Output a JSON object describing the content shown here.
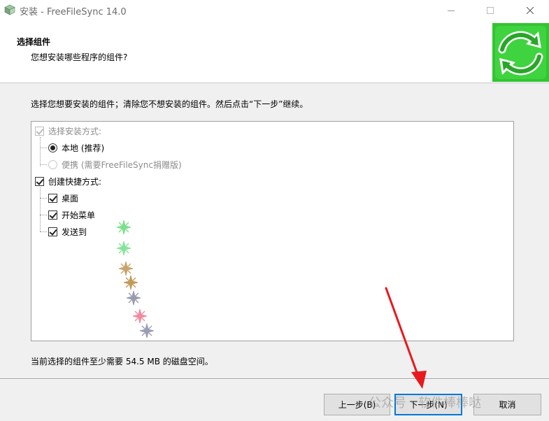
{
  "window": {
    "title": "安装 - FreeFileSync 14.0",
    "controls": [
      "minimize-icon",
      "maximize-icon",
      "close-icon"
    ]
  },
  "header": {
    "title": "选择组件",
    "subtitle": "您想安装哪些程序的组件?",
    "logo_icon": "refresh-arrows-icon",
    "logo_color": "#2fbf2f"
  },
  "main": {
    "instruction": "选择您想要安装的组件；清除您不想安装的组件。然后点击“下一步”继续。",
    "tree": [
      {
        "label": "选择安装方式:",
        "type": "checkbox",
        "checked": true,
        "disabled": true,
        "level": 0
      },
      {
        "label": "本地 (推荐)",
        "type": "radio",
        "checked": true,
        "disabled": false,
        "level": 1
      },
      {
        "label": "便携 (需要FreeFileSync捐赠版)",
        "type": "radio",
        "checked": false,
        "disabled": true,
        "level": 1
      },
      {
        "label": "创建快捷方式:",
        "type": "checkbox",
        "checked": true,
        "disabled": false,
        "level": 0
      },
      {
        "label": "桌面",
        "type": "checkbox",
        "checked": true,
        "disabled": false,
        "level": 1
      },
      {
        "label": "开始菜单",
        "type": "checkbox",
        "checked": true,
        "disabled": false,
        "level": 1
      },
      {
        "label": "发送到",
        "type": "checkbox",
        "checked": true,
        "disabled": false,
        "level": 1
      }
    ],
    "disk_space": "当前选择的组件至少需要 54.5 MB 的磁盘空间。"
  },
  "footer": {
    "back_label": "上一步(B)",
    "next_label": "下一步(N)",
    "cancel_label": "取消"
  },
  "overlay": {
    "watermark": "公众号 · 软件棒棒哒",
    "arrow_color": "#e8191e"
  }
}
